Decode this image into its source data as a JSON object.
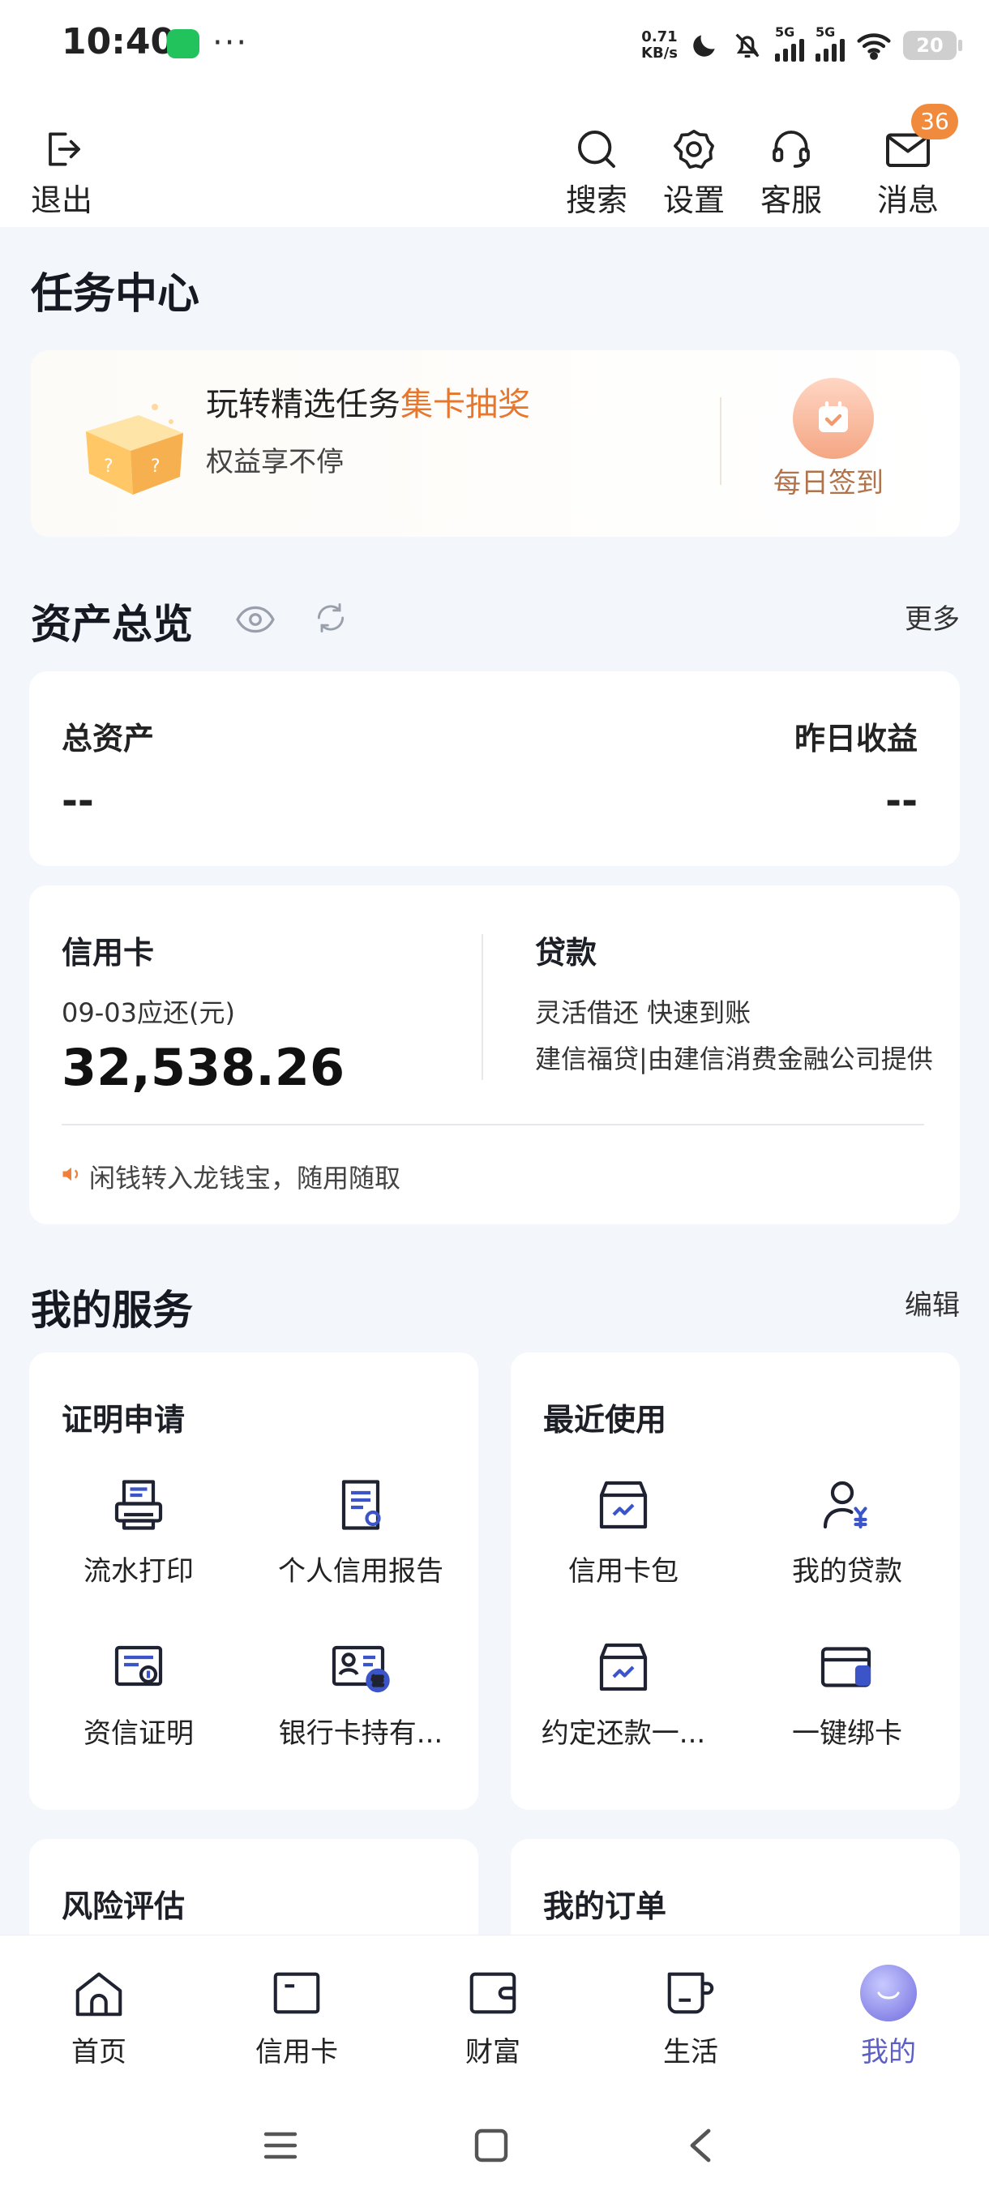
{
  "status_bar": {
    "time": "10:40",
    "dots": "···",
    "speed_value": "0.71",
    "speed_unit": "KB/s",
    "network_1": "5G",
    "network_2": "5G",
    "battery": "20"
  },
  "header": {
    "logout": "退出",
    "search": "搜索",
    "settings": "设置",
    "service": "客服",
    "messages": "消息",
    "messages_badge": "36"
  },
  "task_center": {
    "title": "任务中心",
    "headline": "玩转精选任务",
    "headline_highlight": "集卡抽奖",
    "subline": "权益享不停",
    "checkin": "每日签到"
  },
  "assets": {
    "title": "资产总览",
    "more": "更多",
    "total_label": "总资产",
    "total_value": "--",
    "yesterday_label": "昨日收益",
    "yesterday_value": "--"
  },
  "credit": {
    "cc_title": "信用卡",
    "cc_due": "09-03应还(元)",
    "cc_amount": "32,538.26",
    "loan_title": "贷款",
    "loan_line1": "灵活借还 快速到账",
    "loan_line2": "建信福贷|由建信消费金融公司提供",
    "notice": "闲钱转入龙钱宝，随用随取"
  },
  "services": {
    "title": "我的服务",
    "edit": "编辑",
    "proof": {
      "title": "证明申请",
      "items": [
        "流水打印",
        "个人信用报告",
        "资信证明",
        "银行卡持有..."
      ]
    },
    "recent": {
      "title": "最近使用",
      "items": [
        "信用卡包",
        "我的贷款",
        "约定还款一...",
        "一键绑卡"
      ]
    },
    "risk_title": "风险评估",
    "orders_title": "我的订单"
  },
  "tabs": [
    "首页",
    "信用卡",
    "财富",
    "生活",
    "我的"
  ],
  "colors": {
    "accent_orange": "#e8772e",
    "active_tab": "#5b5fc7",
    "page_bg": "#f3f6fb"
  }
}
